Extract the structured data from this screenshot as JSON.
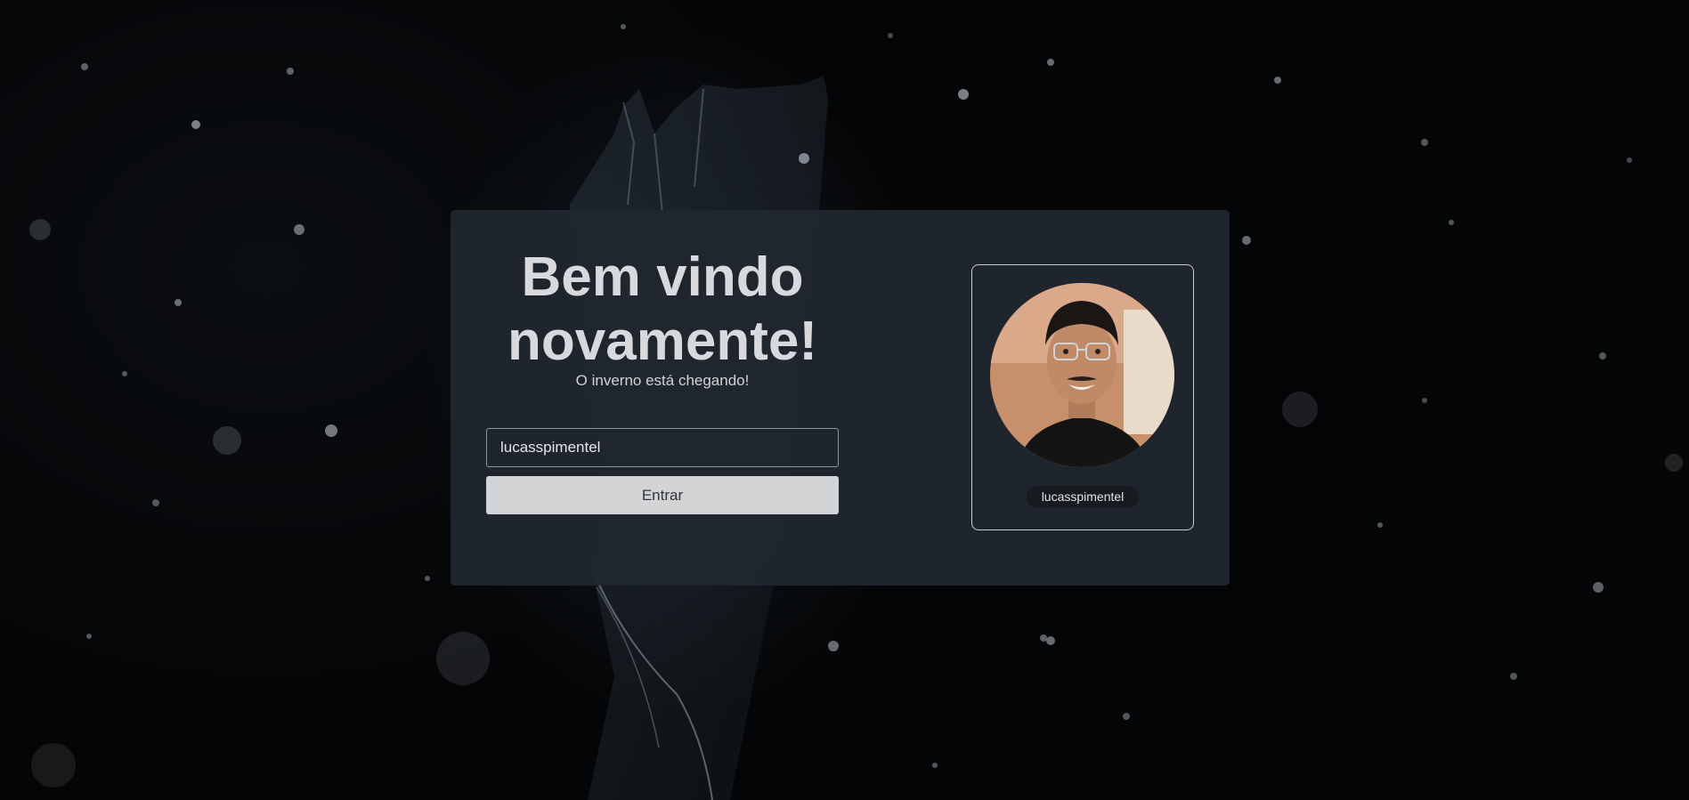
{
  "login": {
    "heading": "Bem vindo novamente!",
    "subtitle": "O inverno está chegando!",
    "username_value": "lucasspimentel",
    "enter_label": "Entrar"
  },
  "profile": {
    "username": "lucasspimentel",
    "avatar_icon": "user-photo-icon"
  },
  "colors": {
    "card_bg": "#20272e",
    "button_bg": "#d3d4d6",
    "text": "#d7d9dc"
  }
}
